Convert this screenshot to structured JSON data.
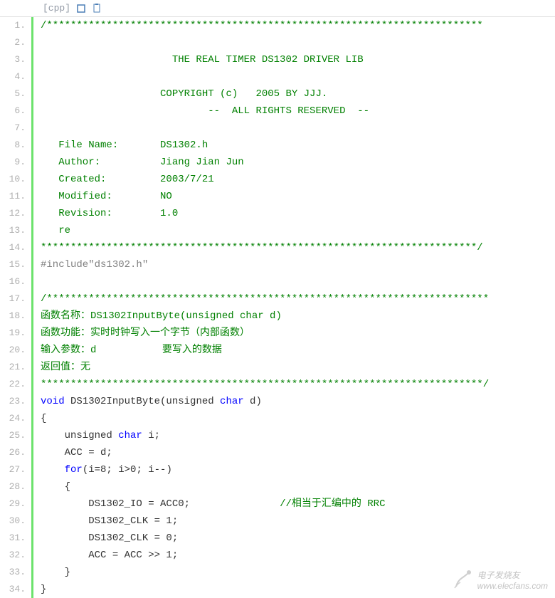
{
  "header": {
    "lang": "[cpp]"
  },
  "lines": [
    {
      "n": "1.",
      "segs": [
        {
          "cls": "comment",
          "t": "/*************************************************************************"
        }
      ]
    },
    {
      "n": "2.",
      "segs": [
        {
          "cls": "comment",
          "t": " "
        }
      ]
    },
    {
      "n": "3.",
      "segs": [
        {
          "cls": "comment",
          "t": "                      THE REAL TIMER DS1302 DRIVER LIB"
        }
      ]
    },
    {
      "n": "4.",
      "segs": [
        {
          "cls": "comment",
          "t": " "
        }
      ]
    },
    {
      "n": "5.",
      "segs": [
        {
          "cls": "comment",
          "t": "                    COPYRIGHT (c)   2005 BY JJJ."
        }
      ]
    },
    {
      "n": "6.",
      "segs": [
        {
          "cls": "comment",
          "t": "                            --  ALL RIGHTS RESERVED  --"
        }
      ]
    },
    {
      "n": "7.",
      "segs": [
        {
          "cls": "comment",
          "t": " "
        }
      ]
    },
    {
      "n": "8.",
      "segs": [
        {
          "cls": "comment",
          "t": "   File Name:       DS1302.h"
        }
      ]
    },
    {
      "n": "9.",
      "segs": [
        {
          "cls": "comment",
          "t": "   Author:          Jiang Jian Jun"
        }
      ]
    },
    {
      "n": "10.",
      "segs": [
        {
          "cls": "comment",
          "t": "   Created:         2003/7/21"
        }
      ]
    },
    {
      "n": "11.",
      "segs": [
        {
          "cls": "comment",
          "t": "   Modified:        NO"
        }
      ]
    },
    {
      "n": "12.",
      "segs": [
        {
          "cls": "comment",
          "t": "   Revision:        1.0"
        }
      ]
    },
    {
      "n": "13.",
      "segs": [
        {
          "cls": "comment",
          "t": "   re"
        }
      ]
    },
    {
      "n": "14.",
      "segs": [
        {
          "cls": "comment",
          "t": "*************************************************************************/"
        }
      ]
    },
    {
      "n": "15.",
      "segs": [
        {
          "cls": "preproc",
          "t": "#include\"ds1302.h\""
        }
      ]
    },
    {
      "n": "16.",
      "segs": [
        {
          "cls": "",
          "t": " "
        }
      ]
    },
    {
      "n": "17.",
      "segs": [
        {
          "cls": "comment",
          "t": "/**************************************************************************"
        }
      ]
    },
    {
      "n": "18.",
      "segs": [
        {
          "cls": "comment",
          "t": "函数名称：DS1302InputByte(unsigned char d)"
        }
      ]
    },
    {
      "n": "19.",
      "segs": [
        {
          "cls": "comment",
          "t": "函数功能：实时时钟写入一个字节（内部函数）"
        }
      ]
    },
    {
      "n": "20.",
      "segs": [
        {
          "cls": "comment",
          "t": "输入参数：d           要写入的数据         "
        }
      ]
    },
    {
      "n": "21.",
      "segs": [
        {
          "cls": "comment",
          "t": "返回值：无"
        }
      ]
    },
    {
      "n": "22.",
      "segs": [
        {
          "cls": "comment",
          "t": "**************************************************************************/"
        }
      ]
    },
    {
      "n": "23.",
      "segs": [
        {
          "cls": "keyword",
          "t": "void"
        },
        {
          "cls": "",
          "t": " DS1302InputByte(unsigned "
        },
        {
          "cls": "keyword",
          "t": "char"
        },
        {
          "cls": "",
          "t": " d)"
        }
      ]
    },
    {
      "n": "24.",
      "segs": [
        {
          "cls": "",
          "t": "{"
        }
      ]
    },
    {
      "n": "25.",
      "segs": [
        {
          "cls": "",
          "t": "    unsigned "
        },
        {
          "cls": "keyword",
          "t": "char"
        },
        {
          "cls": "",
          "t": " i;"
        }
      ]
    },
    {
      "n": "26.",
      "segs": [
        {
          "cls": "",
          "t": "    ACC = d;"
        }
      ]
    },
    {
      "n": "27.",
      "segs": [
        {
          "cls": "",
          "t": "    "
        },
        {
          "cls": "keyword",
          "t": "for"
        },
        {
          "cls": "",
          "t": "(i=8; i>0; i--)"
        }
      ]
    },
    {
      "n": "28.",
      "segs": [
        {
          "cls": "",
          "t": "    {"
        }
      ]
    },
    {
      "n": "29.",
      "segs": [
        {
          "cls": "",
          "t": "        DS1302_IO = ACC0;               "
        },
        {
          "cls": "comment",
          "t": "//相当于汇编中的 RRC"
        }
      ]
    },
    {
      "n": "30.",
      "segs": [
        {
          "cls": "",
          "t": "        DS1302_CLK = 1;"
        }
      ]
    },
    {
      "n": "31.",
      "segs": [
        {
          "cls": "",
          "t": "        DS1302_CLK = 0;"
        }
      ]
    },
    {
      "n": "32.",
      "segs": [
        {
          "cls": "",
          "t": "        ACC = ACC >> 1;"
        }
      ]
    },
    {
      "n": "33.",
      "segs": [
        {
          "cls": "",
          "t": "    }"
        }
      ]
    },
    {
      "n": "34.",
      "segs": [
        {
          "cls": "",
          "t": "}"
        }
      ]
    }
  ],
  "watermark": {
    "text1": "电子发烧友",
    "text2": "www.elecfans.com"
  }
}
